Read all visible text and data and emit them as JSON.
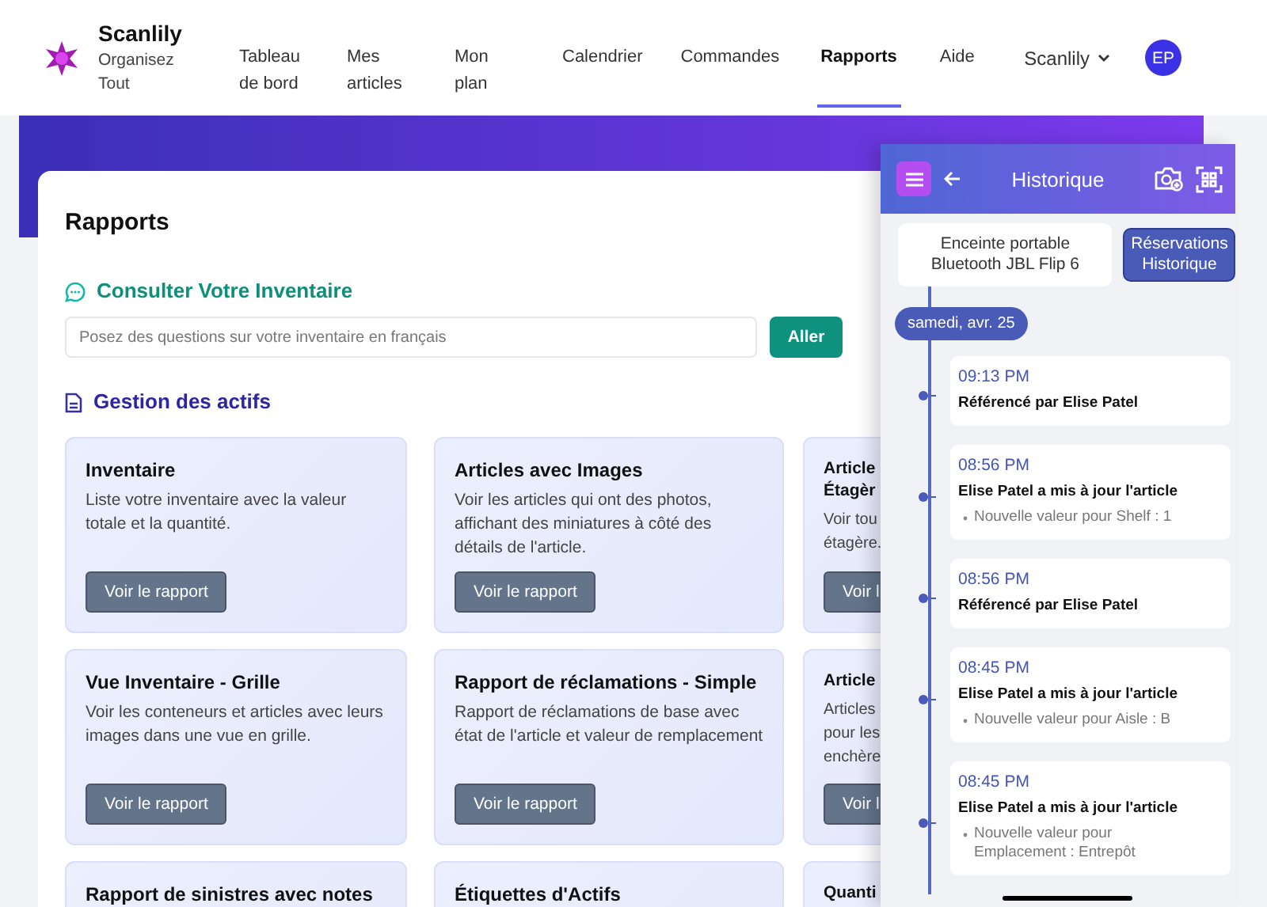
{
  "brand": {
    "name": "Scanlily",
    "tagline": "Organisez Tout"
  },
  "nav": [
    {
      "label": "Tableau de bord",
      "selected": false
    },
    {
      "label": "Mes articles",
      "selected": false
    },
    {
      "label": "Mon plan",
      "selected": false
    },
    {
      "label": "Calendrier",
      "selected": false
    },
    {
      "label": "Commandes",
      "selected": false
    },
    {
      "label": "Rapports",
      "selected": true
    },
    {
      "label": "Aide",
      "selected": false
    }
  ],
  "account": {
    "label": "Scanlily",
    "avatar": "EP"
  },
  "page": {
    "title": "Rapports",
    "ask": {
      "heading": "Consulter Votre Inventaire",
      "placeholder": "Posez des questions sur votre inventaire en français",
      "button": "Aller"
    },
    "section": "Gestion des actifs",
    "cards": [
      {
        "title": "Inventaire",
        "description": "Liste votre inventaire avec la valeur totale et la quantité.",
        "button": "Voir le rapport"
      },
      {
        "title": "Articles avec Images",
        "description": "Voir les articles qui ont des photos, affichant des miniatures à côté des détails de l'article.",
        "button": "Voir le rapport"
      },
      {
        "title": "Article Étagèr",
        "description": "Voir tou étagère.",
        "button": "Voir l"
      },
      {
        "title": "Vue Inventaire - Grille",
        "description": "Voir les conteneurs et articles avec leurs images dans une vue en grille.",
        "button": "Voir le rapport"
      },
      {
        "title": "Rapport de réclamations - Simple",
        "description": "Rapport de réclamations de base avec état de l'article et valeur de remplacement",
        "button": "Voir le rapport"
      },
      {
        "title": "Article",
        "description": "Articles pour les enchère",
        "button": "Voir l"
      },
      {
        "title": "Rapport de sinistres avec notes"
      },
      {
        "title": "Étiquettes d'Actifs"
      },
      {
        "title": "Quanti"
      }
    ]
  },
  "history": {
    "title": "Historique",
    "item": "Enceinte portable Bluetooth JBL Flip 6",
    "button": "Réservations Historique",
    "date": "samedi, avr. 25",
    "events": [
      {
        "time": "09:13 PM",
        "text": "Référencé par Elise Patel"
      },
      {
        "time": "08:56 PM",
        "text": "Elise Patel a mis à jour l'article",
        "details": [
          "Nouvelle valeur pour Shelf : 1"
        ]
      },
      {
        "time": "08:56 PM",
        "text": "Référencé par Elise Patel"
      },
      {
        "time": "08:45 PM",
        "text": "Elise Patel a mis à jour l'article",
        "details": [
          "Nouvelle valeur pour Aisle : B"
        ]
      },
      {
        "time": "08:45 PM",
        "text": "Elise Patel a mis à jour l'article",
        "details": [
          "Nouvelle valeur pour Emplacement : Entrepôt"
        ]
      }
    ]
  }
}
